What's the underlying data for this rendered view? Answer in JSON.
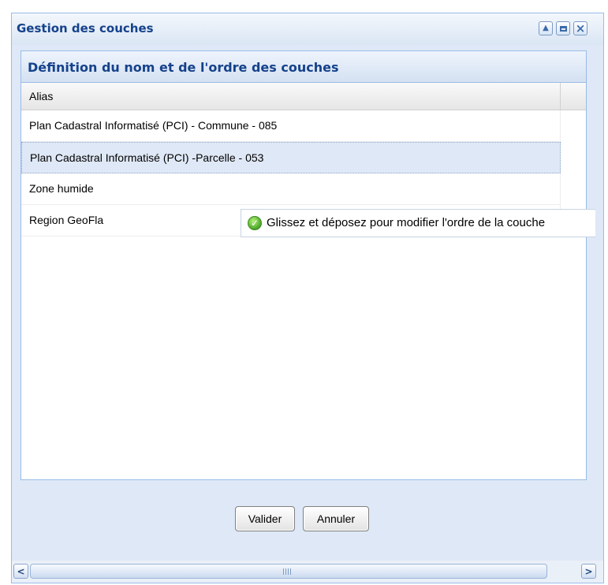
{
  "window": {
    "title": "Gestion des couches",
    "tools": [
      "collapse-icon",
      "maximize-icon",
      "close-icon"
    ]
  },
  "panel": {
    "title": "Définition du nom et de l'ordre des couches",
    "column_header": "Alias",
    "rows": [
      "Plan Cadastral Informatisé (PCI) - Commune - 085",
      "Plan Cadastral Informatisé (PCI) -Parcelle - 053",
      "Zone humide",
      "Region GeoFla"
    ],
    "selected_row": 1
  },
  "tooltip": {
    "icon": "ok-icon",
    "text": "Glissez et déposez pour modifier l'ordre de la couche"
  },
  "buttons": {
    "valider": "Valider",
    "annuler": "Annuler"
  },
  "scrollbar": {
    "icons": [
      "arrow-left-icon",
      "arrow-right-icon"
    ]
  },
  "colors": {
    "title": "#15428b",
    "frame": "#dfe8f6",
    "border": "#99bbe8",
    "selected_row": "#dfe8f6"
  }
}
